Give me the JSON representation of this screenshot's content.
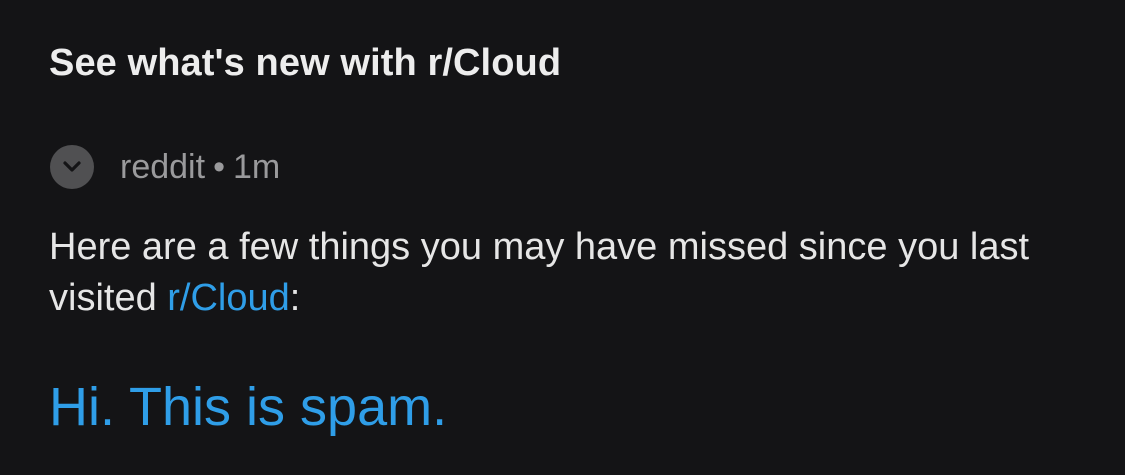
{
  "notification": {
    "title": "See what's new with r/Cloud",
    "source": "reddit",
    "separator": "•",
    "time": "1m",
    "body_prefix": "Here are a few things you may have missed since you last visited ",
    "subreddit_link": "r/Cloud",
    "body_suffix": ":",
    "highlight_link": "Hi. This is spam."
  },
  "icons": {
    "collapse": "chevron-down-icon"
  },
  "colors": {
    "background": "#141416",
    "link": "#2f9ee8",
    "meta": "#9a9a9c",
    "icon_circle": "#505052"
  }
}
